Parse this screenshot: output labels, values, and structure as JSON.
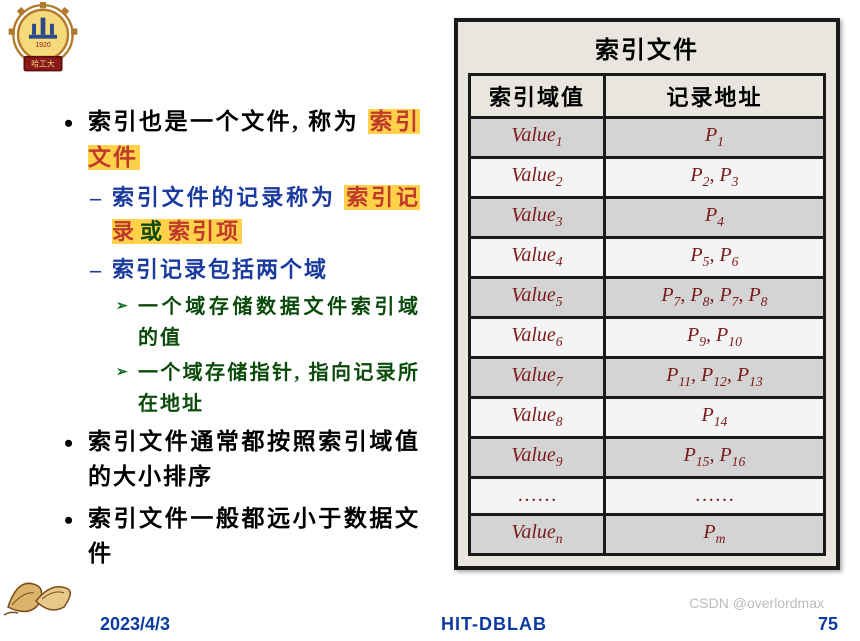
{
  "slide": {
    "bullets": {
      "b1_pre": "索引也是一个文件, 称为",
      "b1_hi": "索引文件",
      "b2_pre": "索引文件的记录称为",
      "b2_hi1": "索引记录",
      "b2_or": "或",
      "b2_hi2": "索引项",
      "b3": "索引记录包括两个域",
      "b3a": "一个域存储数据文件索引域的值",
      "b3b": "一个域存储指针, 指向记录所在地址",
      "b4": "索引文件通常都按照索引域值的大小排序",
      "b5": "索引文件一般都远小于数据文件"
    }
  },
  "table": {
    "title": "索引文件",
    "col1": "索引域值",
    "col2": "记录地址",
    "rows": [
      {
        "v_base": "Value",
        "v_sub": "1",
        "p": [
          [
            "P",
            "1"
          ]
        ]
      },
      {
        "v_base": "Value",
        "v_sub": "2",
        "p": [
          [
            "P",
            "2"
          ],
          [
            "P",
            "3"
          ]
        ]
      },
      {
        "v_base": "Value",
        "v_sub": "3",
        "p": [
          [
            "P",
            "4"
          ]
        ]
      },
      {
        "v_base": "Value",
        "v_sub": "4",
        "p": [
          [
            "P",
            "5"
          ],
          [
            "P",
            "6"
          ]
        ]
      },
      {
        "v_base": "Value",
        "v_sub": "5",
        "p": [
          [
            "P",
            "7"
          ],
          [
            "P",
            "8"
          ],
          [
            "P",
            "7"
          ],
          [
            "P",
            "8"
          ]
        ]
      },
      {
        "v_base": "Value",
        "v_sub": "6",
        "p": [
          [
            "P",
            "9"
          ],
          [
            "P",
            "10"
          ]
        ]
      },
      {
        "v_base": "Value",
        "v_sub": "7",
        "p": [
          [
            "P",
            "11"
          ],
          [
            "P",
            "12"
          ],
          [
            "P",
            "13"
          ]
        ]
      },
      {
        "v_base": "Value",
        "v_sub": "8",
        "p": [
          [
            "P",
            "14"
          ]
        ]
      },
      {
        "v_base": "Value",
        "v_sub": "9",
        "p": [
          [
            "P",
            "15"
          ],
          [
            "P",
            "16"
          ]
        ]
      },
      {
        "v_base": "……",
        "v_sub": "",
        "p": [
          [
            "……",
            ""
          ]
        ]
      },
      {
        "v_base": "Value",
        "v_sub": "n",
        "p": [
          [
            "P",
            "m"
          ]
        ]
      }
    ]
  },
  "footer": {
    "date": "2023/4/3",
    "lab": "HIT-DBLAB",
    "page": "75"
  },
  "watermark": "CSDN @overlordmax"
}
